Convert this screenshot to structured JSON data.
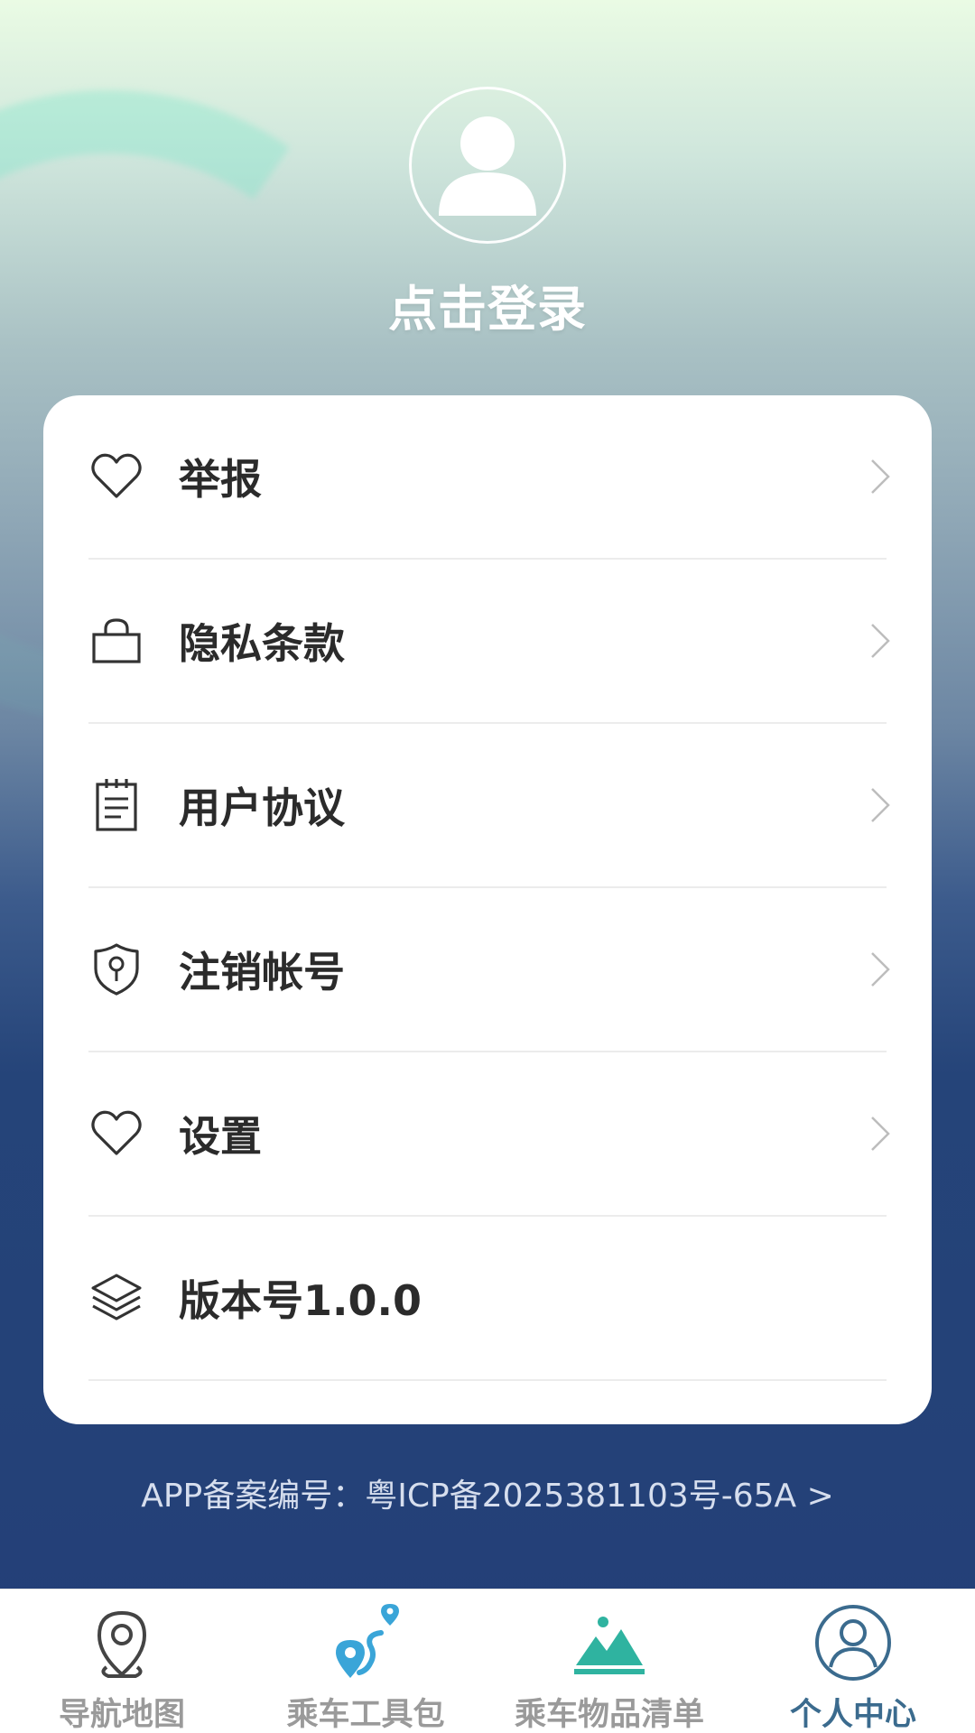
{
  "profile": {
    "login_label": "点击登录",
    "avatar_icon": "user-avatar-icon"
  },
  "menu": {
    "items": [
      {
        "label": "举报",
        "icon": "heart-icon",
        "has_arrow": true
      },
      {
        "label": "隐私条款",
        "icon": "bag-icon",
        "has_arrow": true
      },
      {
        "label": "用户协议",
        "icon": "document-icon",
        "has_arrow": true
      },
      {
        "label": "注销帐号",
        "icon": "shield-key-icon",
        "has_arrow": true
      },
      {
        "label": "设置",
        "icon": "heart-icon",
        "has_arrow": true
      },
      {
        "label": "版本号1.0.0",
        "icon": "layers-icon",
        "has_arrow": false
      }
    ]
  },
  "footer": {
    "icp_text": "APP备案编号：粤ICP备2025381103号-65A >"
  },
  "tabbar": {
    "tabs": [
      {
        "label": "导航地图",
        "icon": "map-pin-icon",
        "active": false
      },
      {
        "label": "乘车工具包",
        "icon": "route-icon",
        "active": false
      },
      {
        "label": "乘车物品清单",
        "icon": "mountain-icon",
        "active": false
      },
      {
        "label": "个人中心",
        "icon": "user-circle-icon",
        "active": true
      }
    ]
  },
  "colors": {
    "active_tab": "#3b6b8e",
    "inactive_tab": "#9a9a9a",
    "teal_icon": "#2fb3a0",
    "blue_icon": "#3aa5d8"
  }
}
